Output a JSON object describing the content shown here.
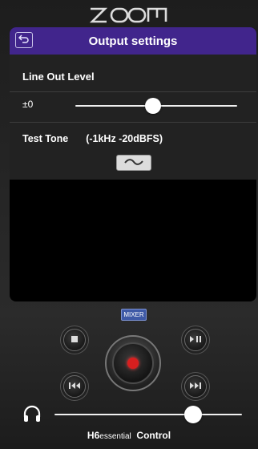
{
  "header": {
    "logo": "ZOOM"
  },
  "screen": {
    "title": "Output settings",
    "back_icon": "back-arrow-icon",
    "line_out": {
      "label": "Line Out Level",
      "value_text": "±0",
      "slider_level": 0.48
    },
    "test_tone": {
      "label": "Test Tone",
      "spec": "(-1kHz -20dBFS)",
      "button_icon": "wave-icon"
    }
  },
  "transport": {
    "mixer_label": "MIXER",
    "buttons": [
      "stop-icon",
      "play-pause-icon",
      "rewind-icon",
      "fast-forward-icon",
      "record-icon"
    ]
  },
  "headphone": {
    "icon": "headphones-icon",
    "volume_level": 0.74
  },
  "footer": {
    "model": "H6",
    "edition": "essential",
    "suffix": "Control"
  },
  "colors": {
    "accent_bar": "#41258c",
    "record": "#d81f1f",
    "mixer_button": "#3e59a6"
  }
}
